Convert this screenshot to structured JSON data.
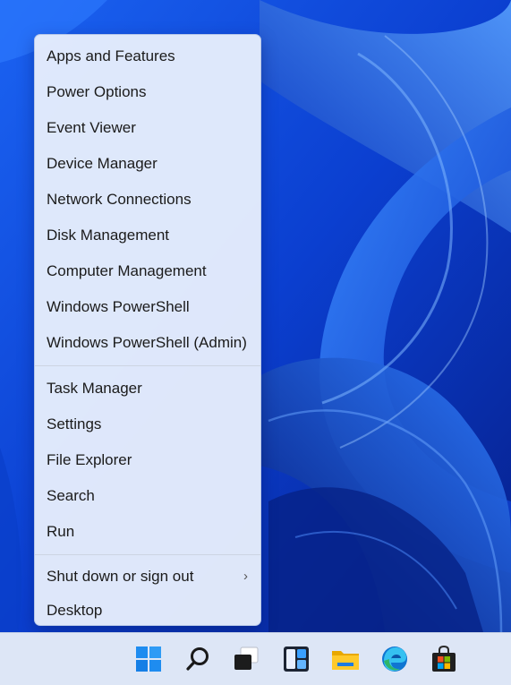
{
  "context_menu": {
    "groups": [
      [
        "Apps and Features",
        "Power Options",
        "Event Viewer",
        "Device Manager",
        "Network Connections",
        "Disk Management",
        "Computer Management",
        "Windows PowerShell",
        "Windows PowerShell (Admin)"
      ],
      [
        "Task Manager",
        "Settings",
        "File Explorer",
        "Search",
        "Run"
      ],
      [
        "Shut down or sign out",
        "Desktop"
      ]
    ],
    "submenu_chevron": "›"
  },
  "taskbar": {
    "icons": [
      "windows-start-icon",
      "search-icon",
      "task-view-icon",
      "widgets-icon",
      "file-explorer-icon",
      "edge-icon",
      "store-icon"
    ]
  },
  "colors": {
    "wallpaper_base": "#0a46d8",
    "menu_background": "#e7eefc",
    "taskbar_background": "#dde6f6",
    "start_blue": "#1e8cf0"
  }
}
